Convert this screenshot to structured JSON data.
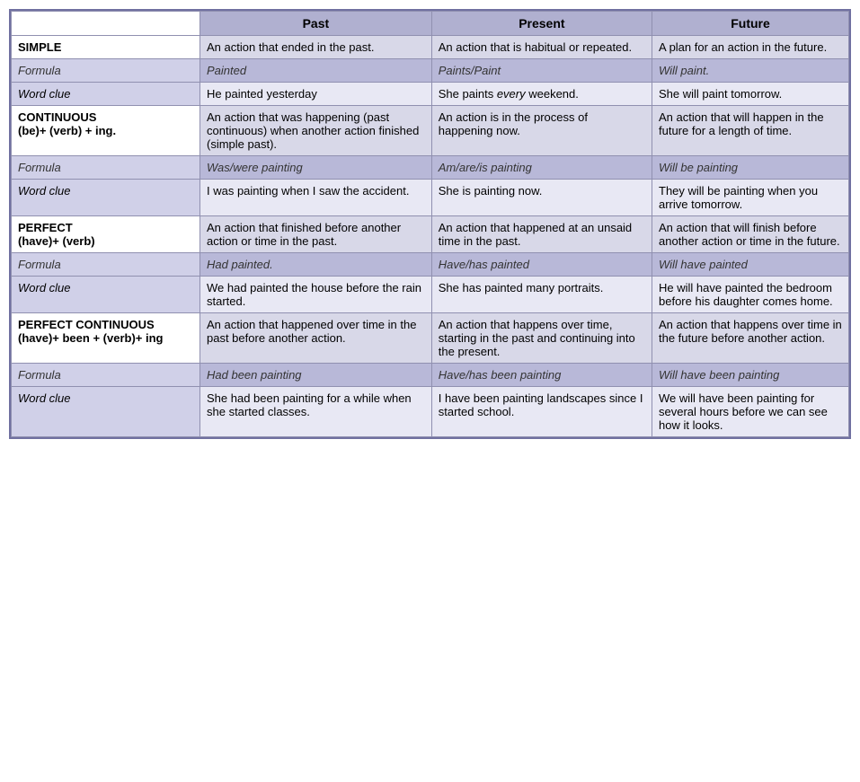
{
  "header": {
    "col1": "",
    "col2": "Past",
    "col3": "Present",
    "col4": "Future"
  },
  "sections": [
    {
      "id": "simple",
      "cat_label": "SIMPLE",
      "cat_sublabel": "",
      "def_past": "An action that ended in the past.",
      "def_present": "An action that is habitual or repeated.",
      "def_future": "A plan for an action in the future.",
      "formula_label": "Formula",
      "formula_past": "Painted",
      "formula_present": "Paints/Paint",
      "formula_future": "Will paint.",
      "clue_label": "Word clue",
      "clue_past": "He painted yesterday",
      "clue_past_em": "",
      "clue_present_before": "She paints ",
      "clue_present_em": "every",
      "clue_present_after": " weekend.",
      "clue_future": "She will paint tomorrow."
    },
    {
      "id": "continuous",
      "cat_label": "CONTINUOUS",
      "cat_sublabel": "(be)+ (verb) + ing.",
      "def_past": "An action that was happening (past continuous) when another action finished (simple past).",
      "def_present": "An action is in the process of happening now.",
      "def_future": "An action that will happen in the future for a length of time.",
      "formula_label": "Formula",
      "formula_past": "Was/were painting",
      "formula_present": "Am/are/is painting",
      "formula_future": "Will be painting",
      "clue_label": "Word clue",
      "clue_past": "I was painting when I saw the accident.",
      "clue_present": "She is painting now.",
      "clue_future": "They will be painting when you arrive tomorrow."
    },
    {
      "id": "perfect",
      "cat_label": "PERFECT",
      "cat_sublabel": "(have)+ (verb)",
      "def_past": "An action that finished before another action or time in the past.",
      "def_present": "An action that happened at an unsaid time in the past.",
      "def_future": "An action that will finish before another action or time in the future.",
      "formula_label": "Formula",
      "formula_past": "Had painted.",
      "formula_present": "Have/has painted",
      "formula_future": "Will have painted",
      "clue_label": "Word clue",
      "clue_past": "We had painted the house before the rain started.",
      "clue_present": "She has painted many portraits.",
      "clue_future": "He will have painted the bedroom before his daughter comes home."
    },
    {
      "id": "perfect-continuous",
      "cat_label": "PERFECT CONTINUOUS",
      "cat_sublabel": "(have)+ been + (verb)+ ing",
      "def_past": "An action that happened over time in the past before another action.",
      "def_present": "An action that happens over time, starting in the past and continuing into the present.",
      "def_future": "An action that happens over time in the future before another action.",
      "formula_label": "Formula",
      "formula_past": "Had been painting",
      "formula_present": "Have/has been painting",
      "formula_future": "Will have been painting",
      "clue_label": "Word clue",
      "clue_past": "She had been painting for a while when she started classes.",
      "clue_present": "I have been painting landscapes since I started school.",
      "clue_future": "We will have been painting for several hours before we can see how it looks."
    }
  ]
}
